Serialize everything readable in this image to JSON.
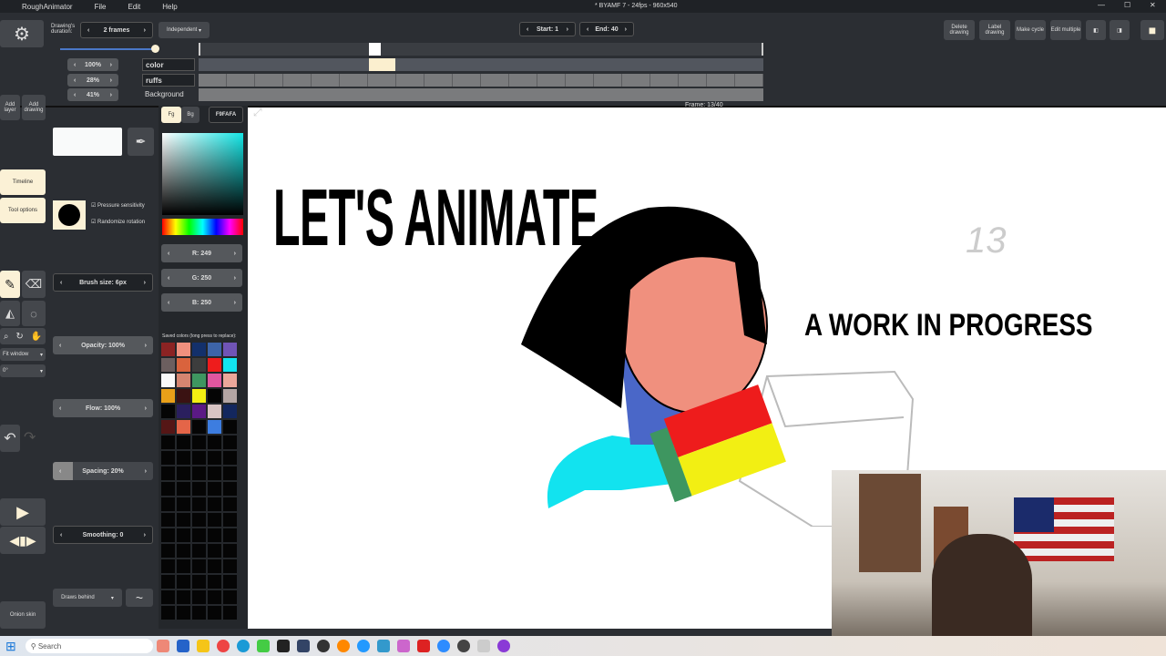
{
  "app": {
    "name": "RoughAnimator",
    "menu": [
      "File",
      "Edit",
      "Help"
    ],
    "doc_title": "* BYAMF 7 - 24fps - 960x540"
  },
  "toolbar": {
    "drawing_duration_label": "Drawing's duration:",
    "duration": "2 frames",
    "mode": "Independent",
    "start": "Start: 1",
    "end": "End: 40",
    "buttons": [
      "Delete drawing",
      "Label drawing",
      "Make cycle",
      "Edit multiple"
    ],
    "frame_readout": "Frame: 13/40"
  },
  "layers": [
    {
      "opacity": "100%",
      "name": "color"
    },
    {
      "opacity": "28%",
      "name": "ruffs"
    },
    {
      "opacity": "41%",
      "name": "Background"
    }
  ],
  "left": {
    "add_layer": "Add layer",
    "add_drawing": "Add drawing",
    "timeline": "Timeline",
    "tool_options": "Tool options",
    "fit": "Fit window",
    "rotation": "0°",
    "onion": "Onion skin"
  },
  "brush": {
    "pressure": "Pressure sensitivity",
    "randomize": "Randomize rotation",
    "size": "Brush size: 6px",
    "opacity": "Opacity: 100%",
    "flow": "Flow: 100%",
    "spacing": "Spacing: 20%",
    "smoothing": "Smoothing: 0",
    "draws_behind": "Draws behind"
  },
  "color": {
    "fg": "Fg",
    "bg": "Bg",
    "hex": "F9FAFA",
    "r": "R: 249",
    "g": "G: 250",
    "b": "B: 250",
    "saved_label": "Saved colors (long press to replace):",
    "saved": [
      "#8b2323",
      "#f0907e",
      "#13306b",
      "#3d64a8",
      "#7054b6",
      "#6c5f5f",
      "#d9633d",
      "#3d3d3d",
      "#ee1c1c",
      "#12e3ef",
      "#fafafa",
      "#d58570",
      "#3e9660",
      "#e056a0",
      "#eca79a",
      "#e9a019",
      "#3a1212",
      "#f2ef13",
      "#050505",
      "#b4a6a4",
      "#050505",
      "#2a1f5e",
      "#5b1a85",
      "#d8c4c4",
      "#13275e",
      "#551616",
      "#e46548",
      "#050505",
      "#3d7de0",
      "#050505"
    ]
  },
  "canvas": {
    "title": "LET'S ANIMATE",
    "subtitle": "A WORK IN PROGRESS",
    "sketch_number": "13"
  },
  "taskbar": {
    "search": "Search"
  }
}
